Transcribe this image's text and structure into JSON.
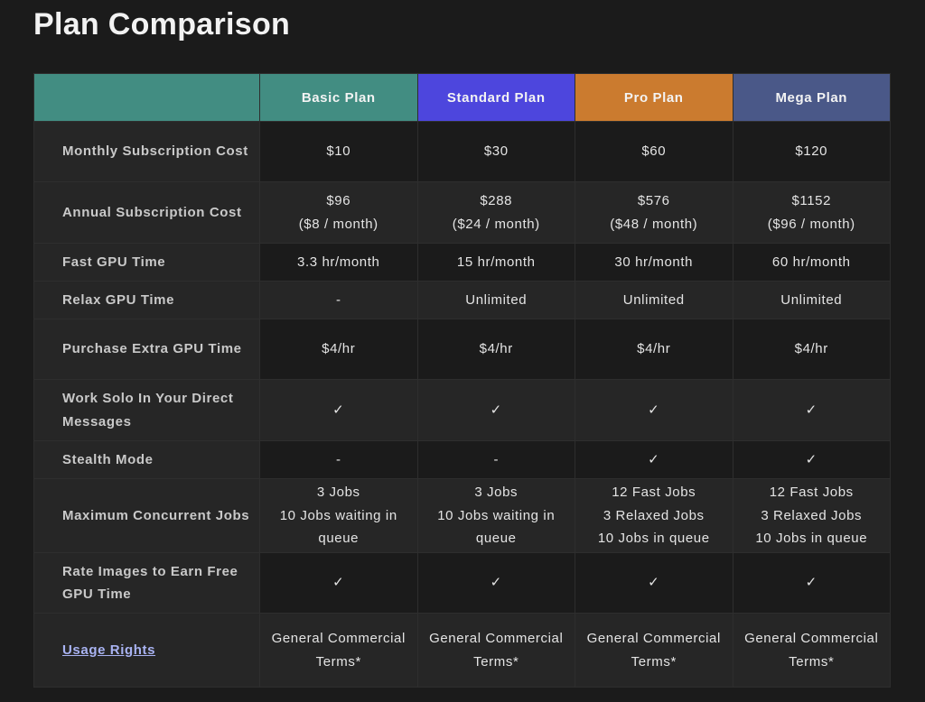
{
  "page": {
    "title": "Plan Comparison"
  },
  "plans": [
    {
      "name": "Basic Plan",
      "color": "#428d82"
    },
    {
      "name": "Standard Plan",
      "color": "#4d46dd"
    },
    {
      "name": "Pro Plan",
      "color": "#cb7b2f"
    },
    {
      "name": "Mega Plan",
      "color": "#4a5888"
    }
  ],
  "rows": [
    {
      "label": "Monthly Subscription Cost",
      "values": [
        [
          "$10"
        ],
        [
          "$30"
        ],
        [
          "$60"
        ],
        [
          "$120"
        ]
      ]
    },
    {
      "label": "Annual Subscription Cost",
      "values": [
        [
          "$96",
          "($8 / month)"
        ],
        [
          "$288",
          "($24 / month)"
        ],
        [
          "$576",
          "($48 / month)"
        ],
        [
          "$1152",
          "($96 / month)"
        ]
      ]
    },
    {
      "label": "Fast GPU Time",
      "values": [
        [
          "3.3 hr/month"
        ],
        [
          "15 hr/month"
        ],
        [
          "30 hr/month"
        ],
        [
          "60 hr/month"
        ]
      ]
    },
    {
      "label": "Relax GPU Time",
      "values": [
        [
          "-"
        ],
        [
          "Unlimited"
        ],
        [
          "Unlimited"
        ],
        [
          "Unlimited"
        ]
      ]
    },
    {
      "label": "Purchase Extra GPU Time",
      "values": [
        [
          "$4/hr"
        ],
        [
          "$4/hr"
        ],
        [
          "$4/hr"
        ],
        [
          "$4/hr"
        ]
      ]
    },
    {
      "label": "Work Solo In Your Direct Messages",
      "values": [
        [
          "✓"
        ],
        [
          "✓"
        ],
        [
          "✓"
        ],
        [
          "✓"
        ]
      ]
    },
    {
      "label": "Stealth Mode",
      "values": [
        [
          "-"
        ],
        [
          "-"
        ],
        [
          "✓"
        ],
        [
          "✓"
        ]
      ]
    },
    {
      "label": "Maximum Concurrent Jobs",
      "values": [
        [
          "3 Jobs",
          "10 Jobs waiting in queue"
        ],
        [
          "3 Jobs",
          "10 Jobs waiting in queue"
        ],
        [
          "12 Fast Jobs",
          "3 Relaxed Jobs",
          "10 Jobs in queue"
        ],
        [
          "12 Fast Jobs",
          "3 Relaxed Jobs",
          "10 Jobs in queue"
        ]
      ]
    },
    {
      "label": "Rate Images to Earn Free GPU Time",
      "values": [
        [
          "✓"
        ],
        [
          "✓"
        ],
        [
          "✓"
        ],
        [
          "✓"
        ]
      ]
    },
    {
      "label": "Usage Rights",
      "is_link": true,
      "values": [
        [
          "General Commercial Terms*"
        ],
        [
          "General Commercial Terms*"
        ],
        [
          "General Commercial Terms*"
        ],
        [
          "General Commercial Terms*"
        ]
      ]
    }
  ]
}
